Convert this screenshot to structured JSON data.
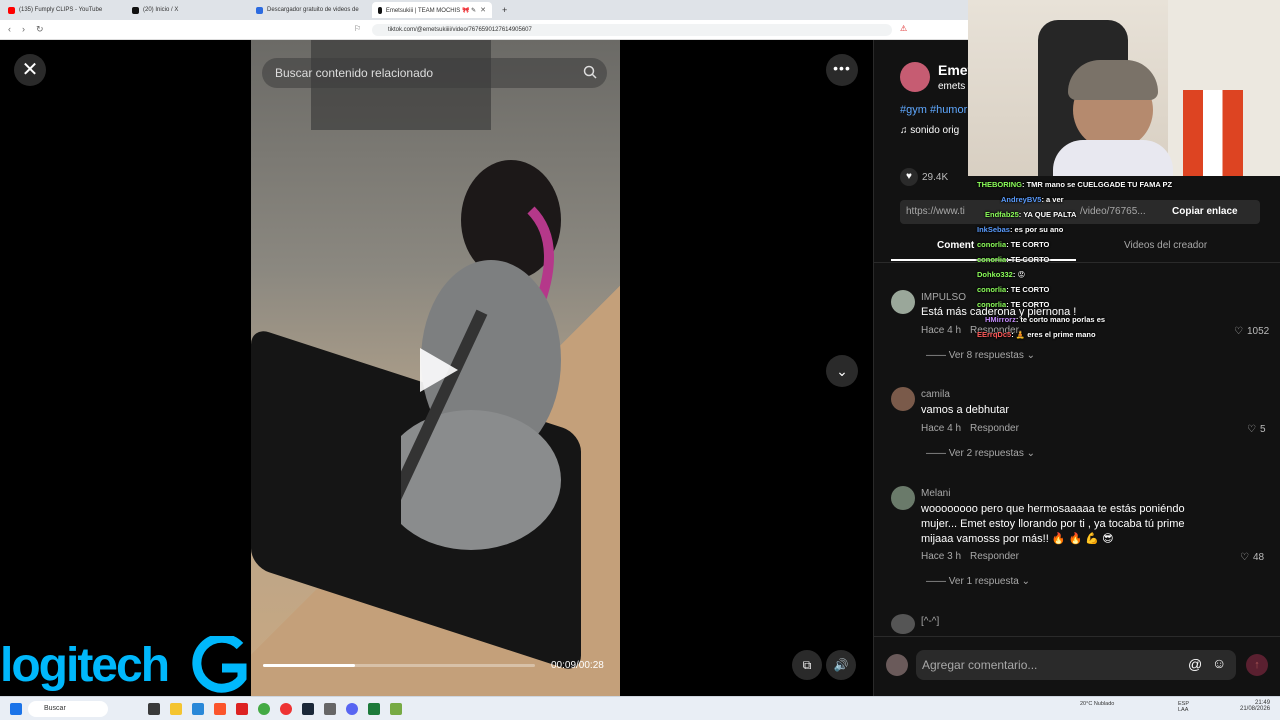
{
  "browser": {
    "tabs": [
      {
        "label": "(135) Fumply CLIPS - YouTube",
        "color": "#ff0000"
      },
      {
        "label": "(20) Inicio / X",
        "color": "#111111"
      },
      {
        "label": "Descargador gratuito de videos de",
        "color": "#2c6be0"
      },
      {
        "label": "Emetsukiii | TEAM MOCHIS 🎀 ✎",
        "color": "#111111"
      }
    ],
    "url": "tiktok.com/@emetsukiiii/video/7676590127614905607"
  },
  "video": {
    "search_placeholder": "Buscar contenido relacionado",
    "time": "00:09/00:28",
    "progress_fraction": 0.34
  },
  "panel": {
    "author_name": "Emet",
    "author_handle": "emets",
    "hashtags": "#gym #humor",
    "sound": "sonido orig",
    "likes": "29.4K",
    "link_text": "https://www.ti",
    "link_tail": "/video/76765...",
    "copy_link": "Copiar enlace",
    "tab_comments": "Coment",
    "tab_creator": "Videos del creador",
    "comments": [
      {
        "user": "IMPULSO",
        "text": "Está más caderona y piernona !",
        "time": "Hace 4 h",
        "reply": "Responder",
        "likes": "1052",
        "replies": "Ver 8 respuestas"
      },
      {
        "user": "camila",
        "text": "vamos a debhutar",
        "time": "Hace 4 h",
        "reply": "Responder",
        "likes": "5",
        "replies": "Ver 2 respuestas"
      },
      {
        "user": "Melani",
        "text": "woooooooo pero que hermosaaaaa te estás poniéndo mujer... Emet estoy llorando por ti , ya tocaba tú prime mijaaa vamosss por más!! 🔥 🔥 💪 😎",
        "time": "Hace 3 h",
        "reply": "Responder",
        "likes": "48",
        "replies": "Ver 1 respuesta"
      },
      {
        "user": "[^-^]"
      }
    ],
    "add_comment_placeholder": "Agregar comentario..."
  },
  "chat": [
    {
      "user": "THEBORING",
      "msg": ": TMR mano se CUELGGADE TU FAMA PZ",
      "color": "#8cff5a"
    },
    {
      "user": "AndreyBV5",
      "msg": ": a ver",
      "color": "#5a9cff"
    },
    {
      "user": "Endfab25",
      "msg": ": YA QUE PALTA",
      "color": "#8cff5a"
    },
    {
      "user": "InkSebas",
      "msg": ": es por su ano",
      "color": "#5a9cff"
    },
    {
      "user": "conorlia",
      "msg": ": TE CORTO",
      "color": "#8cff5a"
    },
    {
      "user": "conorlia",
      "msg": ": TE CORTO",
      "color": "#8cff5a"
    },
    {
      "user": "Dohko332",
      "msg": ": 😡",
      "color": "#8cff5a"
    },
    {
      "user": "conorlia",
      "msg": ": TE CORTO",
      "color": "#8cff5a"
    },
    {
      "user": "conorlia",
      "msg": ": TE CORTO",
      "color": "#8cff5a"
    },
    {
      "user": "HMirrorz",
      "msg": ": te corto mano porlas es",
      "color": "#c58cff"
    },
    {
      "user": "EErrqDc5",
      "msg": ": 🧘 eres el prime mano",
      "color": "#ff5a5a"
    }
  ],
  "overlay": {
    "brand": "logitech"
  },
  "taskbar": {
    "search": "Buscar",
    "weather": "20°C Nublado",
    "lang": "ESP LAA",
    "time": "21:49",
    "date": "21/08/2026"
  }
}
